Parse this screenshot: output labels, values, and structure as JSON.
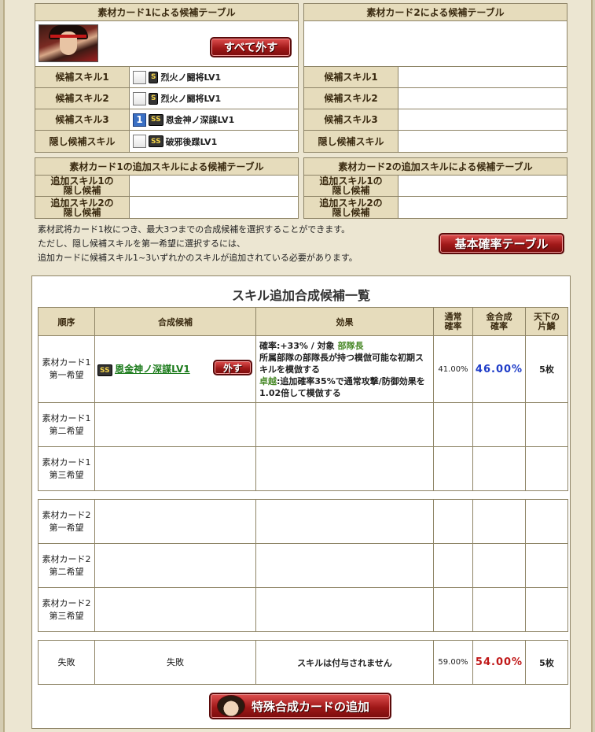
{
  "card1": {
    "title": "素材カード1による候補テーブル",
    "remove_all_label": "すべて外す",
    "rows": [
      {
        "label": "候補スキル1",
        "rank": "S",
        "skill": "烈火ノ闘将LV1"
      },
      {
        "label": "候補スキル2",
        "rank": "S",
        "skill": "烈火ノ闘将LV1"
      },
      {
        "label": "候補スキル3",
        "rank": "SS",
        "skill": "恩金神ノ深謀LV1",
        "selected": "1"
      },
      {
        "label": "隠し候補スキル",
        "rank": "SS",
        "skill": "破邪後蹀LV1"
      }
    ]
  },
  "card2": {
    "title": "素材カード2による候補テーブル",
    "rows": [
      {
        "label": "候補スキル1"
      },
      {
        "label": "候補スキル2"
      },
      {
        "label": "候補スキル3"
      },
      {
        "label": "隠し候補スキル"
      }
    ]
  },
  "add1": {
    "title": "素材カード1の追加スキルによる候補テーブル",
    "row1": "追加スキル1の\n隠し候補",
    "row2": "追加スキル2の\n隠し候補"
  },
  "add2": {
    "title": "素材カード2の追加スキルによる候補テーブル",
    "row1": "追加スキル1の\n隠し候補",
    "row2": "追加スキル2の\n隠し候補"
  },
  "notes": [
    "素材武将カード1枚につき、最大3つまでの合成候補を選択することができます。",
    "ただし、隠し候補スキルを第一希望に選択するには、",
    "追加カードに候補スキル1~3いずれかのスキルが追加されている必要があります。"
  ],
  "basic_table_button": "基本確率テーブル",
  "list": {
    "title": "スキル追加合成候補一覧",
    "headers": {
      "order": "順序",
      "candidate": "合成候補",
      "effect": "効果",
      "normal_rate": "通常\n確率",
      "gold_rate": "金合成\n確率",
      "tenka": "天下の\n片鱗"
    },
    "first": {
      "order": "素材カード1\n第一希望",
      "rank": "SS",
      "candidate": "恩金神ノ深謀LV1",
      "remove_label": "外す",
      "effect_prefix": "確率:+33% / 対象 ",
      "effect_target": "部隊長",
      "effect_line2": "所属部隊の部隊長が持つ模倣可能な初期スキルを模倣する",
      "effect_tag": "卓越",
      "effect_line3": ":追加確率35%で通常攻撃/防御効果を1.02倍して模倣する",
      "normal_rate": "41.00%",
      "gold_rate": "46.00%",
      "tenka": "5枚"
    },
    "card1_rows": [
      "素材カード1\n第二希望",
      "素材カード1\n第三希望"
    ],
    "card2_rows": [
      "素材カード2\n第一希望",
      "素材カード2\n第二希望",
      "素材カード2\n第三希望"
    ],
    "fail": {
      "order": "失敗",
      "candidate": "失敗",
      "effect": "スキルは付与されません",
      "normal_rate": "59.00%",
      "gold_rate": "54.00%",
      "tenka": "5枚"
    }
  },
  "special_button": "特殊合成カードの追加"
}
